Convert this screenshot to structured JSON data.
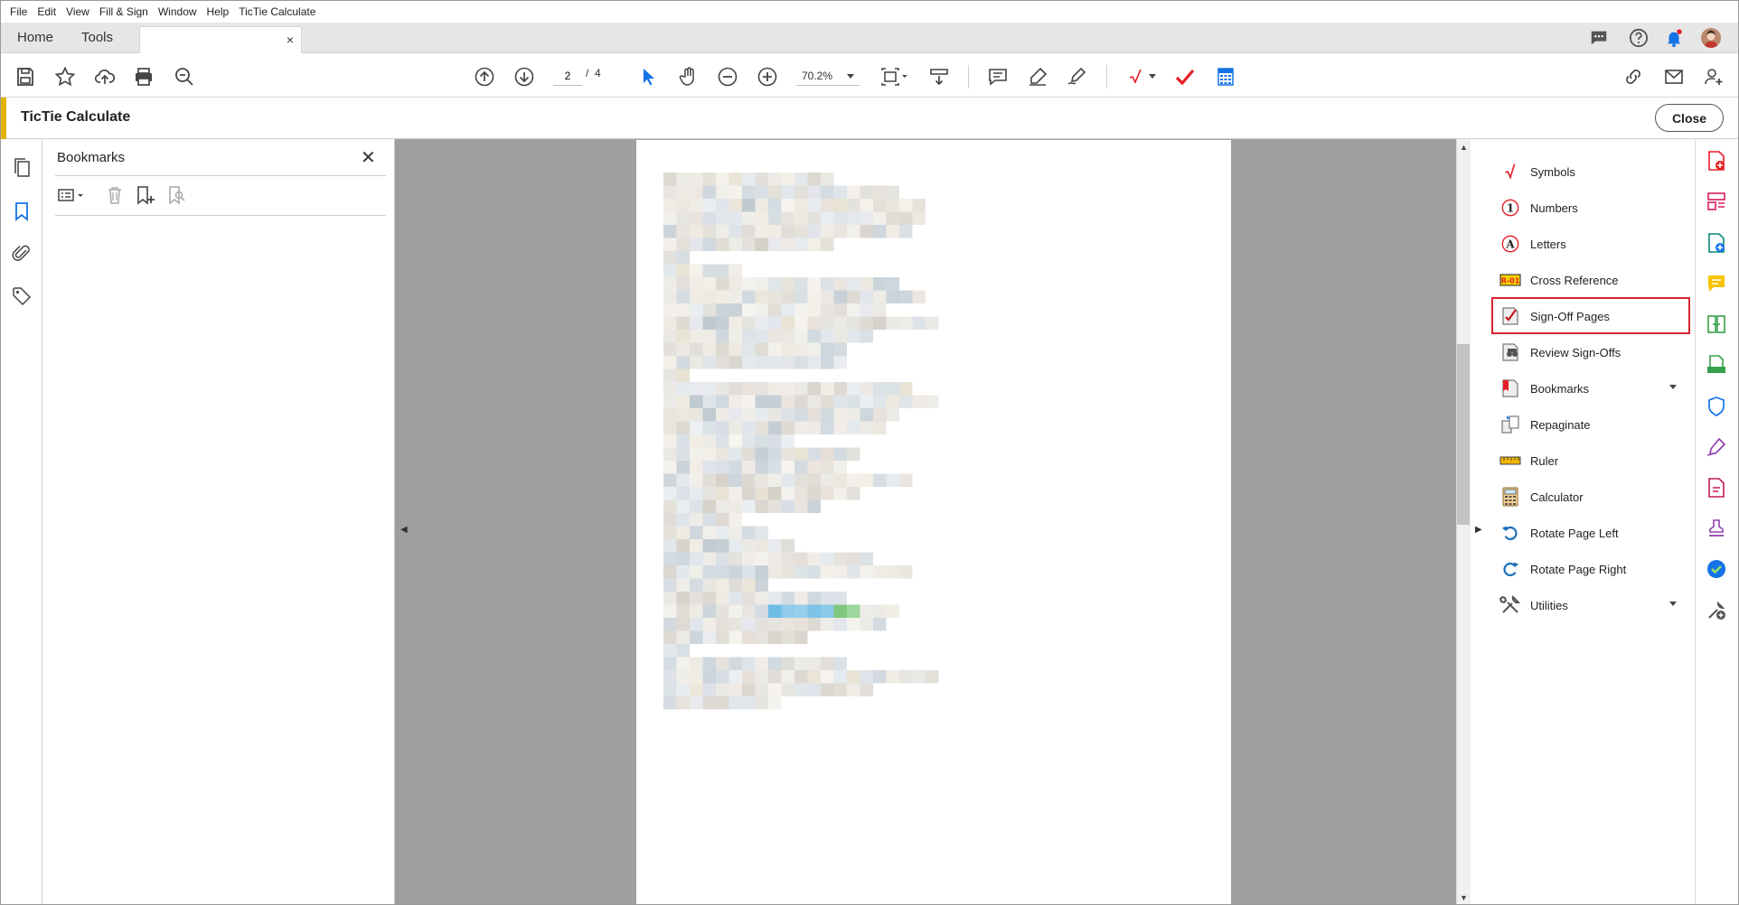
{
  "menu": [
    "File",
    "Edit",
    "View",
    "Fill & Sign",
    "Window",
    "Help",
    "TicTie Calculate"
  ],
  "tabs": {
    "home": "Home",
    "tools": "Tools",
    "doc_close": "×"
  },
  "toolbar": {
    "page_current": "2",
    "page_sep": "/",
    "page_total": "4",
    "zoom": "70.2%"
  },
  "tool_panel": {
    "title": "TicTie Calculate",
    "close_label": "Close"
  },
  "bookmarks": {
    "title": "Bookmarks",
    "close": "✕"
  },
  "right_tools": [
    {
      "label": "Symbols",
      "icon": "checkmark-symbol-icon"
    },
    {
      "label": "Numbers",
      "icon": "circled-number-icon"
    },
    {
      "label": "Letters",
      "icon": "circled-letter-icon"
    },
    {
      "label": "Cross Reference",
      "icon": "cross-reference-icon"
    },
    {
      "label": "Sign-Off Pages",
      "icon": "sign-off-pages-icon"
    },
    {
      "label": "Review Sign-Offs",
      "icon": "review-sign-offs-icon"
    },
    {
      "label": "Bookmarks",
      "icon": "bookmarks-tool-icon"
    },
    {
      "label": "Repaginate",
      "icon": "repaginate-icon"
    },
    {
      "label": "Ruler",
      "icon": "ruler-icon"
    },
    {
      "label": "Calculator",
      "icon": "calculator-icon"
    },
    {
      "label": "Rotate Page Left",
      "icon": "rotate-left-icon"
    },
    {
      "label": "Rotate Page Right",
      "icon": "rotate-right-icon"
    },
    {
      "label": "Utilities",
      "icon": "utilities-icon"
    }
  ],
  "colors": {
    "accent_yellow": "#e0b400",
    "highlight_red": "#d9232f",
    "check_red": "#e41e26",
    "link_blue": "#1473e6"
  }
}
